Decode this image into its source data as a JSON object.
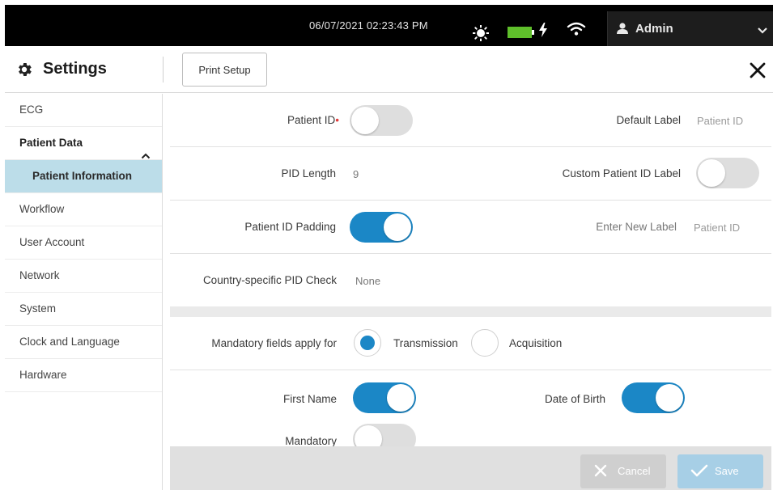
{
  "status_bar": {
    "datetime": "06/07/2021 02:23:43 PM",
    "user": "Admin",
    "icons": [
      "brightness-icon",
      "battery-icon",
      "charging-bolt-icon",
      "wifi-icon",
      "user-icon",
      "chevron-down-icon"
    ]
  },
  "header": {
    "title": "Settings",
    "print_setup_label": "Print Setup"
  },
  "sidebar": {
    "items": [
      {
        "label": "ECG"
      },
      {
        "label": "Patient Data",
        "expanded": true
      },
      {
        "label": "Patient Information",
        "selected": true
      },
      {
        "label": "Workflow"
      },
      {
        "label": "User Account"
      },
      {
        "label": "Network"
      },
      {
        "label": "System"
      },
      {
        "label": "Clock and Language"
      },
      {
        "label": "Hardware"
      }
    ]
  },
  "patient_id": {
    "label": "Patient ID",
    "required_mark": "•",
    "enabled": false,
    "default_label_label": "Default Label",
    "default_label_value": "Patient ID"
  },
  "pid_length": {
    "label": "PID Length",
    "value": "9",
    "custom_label_label": "Custom Patient ID Label",
    "custom_label_enabled": false
  },
  "pid_padding": {
    "label": "Patient ID Padding",
    "enabled": true,
    "new_label_label": "Enter New Label",
    "new_label_placeholder": "Patient ID"
  },
  "country_check": {
    "label": "Country-specific PID Check",
    "value": "None"
  },
  "mandatory_apply": {
    "label": "Mandatory fields apply for",
    "options": [
      "Transmission",
      "Acquisition"
    ],
    "selected": "Transmission"
  },
  "first_name": {
    "label": "First Name",
    "enabled": true,
    "mandatory_label": "Mandatory",
    "mandatory_enabled": false
  },
  "date_of_birth": {
    "label": "Date of Birth",
    "enabled": true
  },
  "footer": {
    "cancel_label": "Cancel",
    "save_label": "Save"
  },
  "colors": {
    "accent": "#1b87c6",
    "selected_nav": "#bcdde9",
    "topbar": "#000000",
    "battery": "#5fbf2b"
  }
}
